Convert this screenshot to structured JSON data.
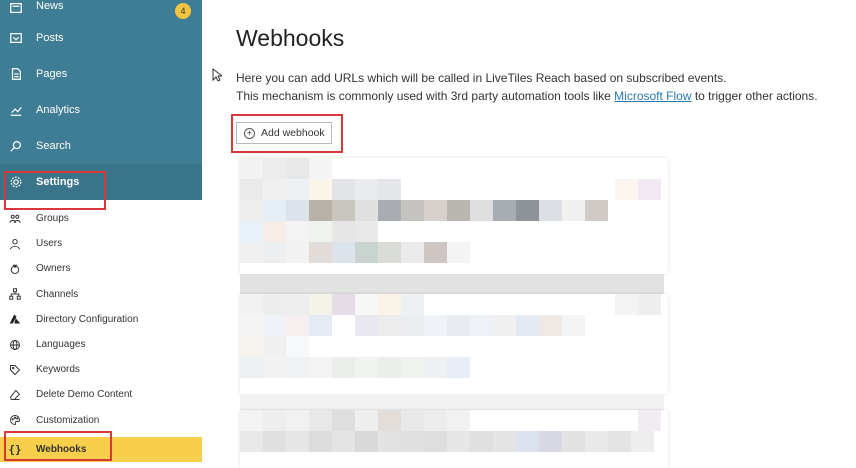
{
  "nav": {
    "items": [
      {
        "label": "News",
        "icon": "news-icon",
        "badge": "4"
      },
      {
        "label": "Posts",
        "icon": "posts-icon"
      },
      {
        "label": "Pages",
        "icon": "pages-icon"
      },
      {
        "label": "Analytics",
        "icon": "analytics-icon"
      },
      {
        "label": "Search",
        "icon": "search-icon"
      },
      {
        "label": "Settings",
        "icon": "gear-icon"
      }
    ]
  },
  "settings_menu": {
    "items": [
      {
        "label": "Groups",
        "icon": "groups-icon"
      },
      {
        "label": "Users",
        "icon": "users-icon"
      },
      {
        "label": "Owners",
        "icon": "owners-icon"
      },
      {
        "label": "Channels",
        "icon": "channels-icon"
      },
      {
        "label": "Directory Configuration",
        "icon": "azure-icon"
      },
      {
        "label": "Languages",
        "icon": "globe-icon"
      },
      {
        "label": "Keywords",
        "icon": "tag-icon"
      },
      {
        "label": "Delete Demo Content",
        "icon": "eraser-icon"
      },
      {
        "label": "Customization",
        "icon": "palette-icon"
      },
      {
        "label": "Webhooks",
        "icon": "braces-icon"
      }
    ]
  },
  "page": {
    "title": "Webhooks",
    "description_line1": "Here you can add URLs which will be called in LiveTiles Reach based on subscribed events.",
    "description_line2_before": "This mechanism is commonly used with 3rd party automation tools like ",
    "description_link": "Microsoft Flow",
    "description_line2_after": " to trigger other actions.",
    "add_button_label": "Add webhook",
    "footer_partial": "KXCO ... 0N ... ontai ..."
  },
  "colors": {
    "sidebar_top": "#3f7d94",
    "selected_item": "#f8cf4a",
    "highlight": "#d9383a",
    "badge": "#f5c542",
    "link": "#2a7ab0"
  }
}
